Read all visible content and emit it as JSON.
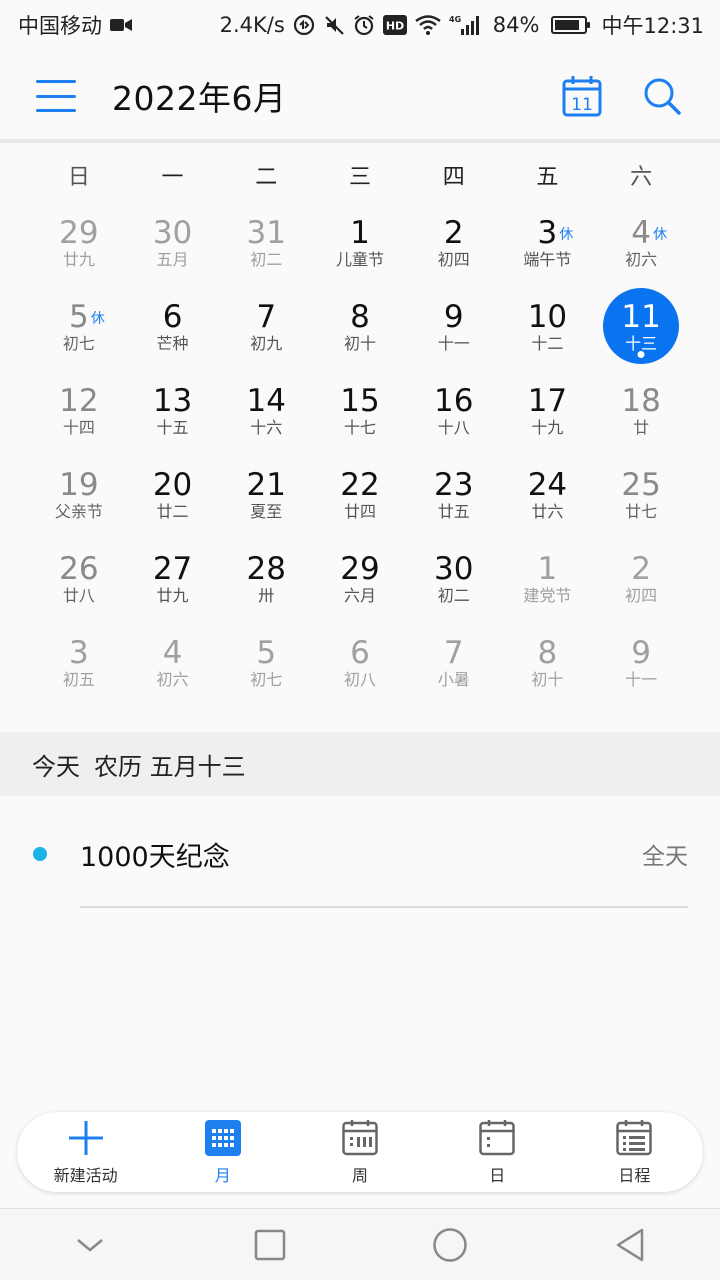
{
  "status_bar": {
    "carrier": "中国移动",
    "speed": "2.4K/s",
    "hd": "HD",
    "network": "4G",
    "battery": "84%",
    "battery_level": 84,
    "time": "中午12:31"
  },
  "header": {
    "title": "2022年6月",
    "today_icon_day": "11"
  },
  "weekdays": [
    "日",
    "一",
    "二",
    "三",
    "四",
    "五",
    "六"
  ],
  "days": [
    {
      "num": "29",
      "lunar": "廿九",
      "muted": true
    },
    {
      "num": "30",
      "lunar": "五月",
      "muted": true
    },
    {
      "num": "31",
      "lunar": "初二",
      "muted": true
    },
    {
      "num": "1",
      "lunar": "儿童节"
    },
    {
      "num": "2",
      "lunar": "初四"
    },
    {
      "num": "3",
      "lunar": "端午节",
      "holiday": "休"
    },
    {
      "num": "4",
      "lunar": "初六",
      "weekend": true,
      "holiday": "休"
    },
    {
      "num": "5",
      "lunar": "初七",
      "weekend": true,
      "holiday": "休"
    },
    {
      "num": "6",
      "lunar": "芒种"
    },
    {
      "num": "7",
      "lunar": "初九"
    },
    {
      "num": "8",
      "lunar": "初十"
    },
    {
      "num": "9",
      "lunar": "十一"
    },
    {
      "num": "10",
      "lunar": "十二"
    },
    {
      "num": "11",
      "lunar": "十三",
      "today": true
    },
    {
      "num": "12",
      "lunar": "十四",
      "weekend": true
    },
    {
      "num": "13",
      "lunar": "十五"
    },
    {
      "num": "14",
      "lunar": "十六"
    },
    {
      "num": "15",
      "lunar": "十七"
    },
    {
      "num": "16",
      "lunar": "十八"
    },
    {
      "num": "17",
      "lunar": "十九"
    },
    {
      "num": "18",
      "lunar": "廿",
      "weekend": true
    },
    {
      "num": "19",
      "lunar": "父亲节",
      "weekend": true
    },
    {
      "num": "20",
      "lunar": "廿二"
    },
    {
      "num": "21",
      "lunar": "夏至"
    },
    {
      "num": "22",
      "lunar": "廿四"
    },
    {
      "num": "23",
      "lunar": "廿五"
    },
    {
      "num": "24",
      "lunar": "廿六"
    },
    {
      "num": "25",
      "lunar": "廿七",
      "weekend": true
    },
    {
      "num": "26",
      "lunar": "廿八",
      "weekend": true
    },
    {
      "num": "27",
      "lunar": "廿九"
    },
    {
      "num": "28",
      "lunar": "卅"
    },
    {
      "num": "29",
      "lunar": "六月"
    },
    {
      "num": "30",
      "lunar": "初二"
    },
    {
      "num": "1",
      "lunar": "建党节",
      "muted": true
    },
    {
      "num": "2",
      "lunar": "初四",
      "muted": true
    },
    {
      "num": "3",
      "lunar": "初五",
      "muted": true
    },
    {
      "num": "4",
      "lunar": "初六",
      "muted": true
    },
    {
      "num": "5",
      "lunar": "初七",
      "muted": true
    },
    {
      "num": "6",
      "lunar": "初八",
      "muted": true
    },
    {
      "num": "7",
      "lunar": "小暑",
      "muted": true
    },
    {
      "num": "8",
      "lunar": "初十",
      "muted": true
    },
    {
      "num": "9",
      "lunar": "十一",
      "muted": true
    }
  ],
  "today_band": {
    "today": "今天",
    "lunar": "农历 五月十三"
  },
  "events": [
    {
      "name": "1000天纪念",
      "time": "全天",
      "color": "#1bb3e6"
    }
  ],
  "tabs": [
    {
      "label": "新建活动",
      "icon": "plus-icon"
    },
    {
      "label": "月",
      "icon": "month-grid-icon",
      "active": true
    },
    {
      "label": "周",
      "icon": "week-icon"
    },
    {
      "label": "日",
      "icon": "day-icon"
    },
    {
      "label": "日程",
      "icon": "agenda-icon"
    }
  ],
  "colors": {
    "accent": "#1e7ff0",
    "today_circle": "#0a74f0",
    "holiday": "#1e7ff0",
    "event_dot": "#1bb3e6"
  }
}
